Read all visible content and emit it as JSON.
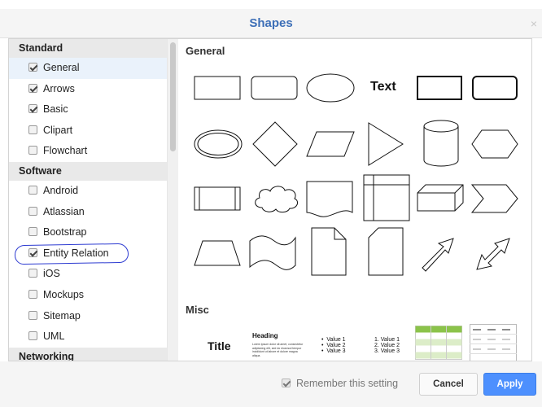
{
  "dialog": {
    "title": "Shapes",
    "close_label": "×"
  },
  "sidebar": {
    "groups": [
      {
        "label": "Standard",
        "items": [
          {
            "label": "General",
            "checked": true,
            "selected": true
          },
          {
            "label": "Arrows",
            "checked": true
          },
          {
            "label": "Basic",
            "checked": true
          },
          {
            "label": "Clipart",
            "checked": false
          },
          {
            "label": "Flowchart",
            "checked": false
          }
        ]
      },
      {
        "label": "Software",
        "items": [
          {
            "label": "Android",
            "checked": false
          },
          {
            "label": "Atlassian",
            "checked": false
          },
          {
            "label": "Bootstrap",
            "checked": false
          },
          {
            "label": "Entity Relation",
            "checked": true,
            "annotated": true
          },
          {
            "label": "iOS",
            "checked": false
          },
          {
            "label": "Mockups",
            "checked": false
          },
          {
            "label": "Sitemap",
            "checked": false
          },
          {
            "label": "UML",
            "checked": false
          }
        ]
      },
      {
        "label": "Networking",
        "items": []
      }
    ]
  },
  "main": {
    "general_title": "General",
    "misc_title": "Misc",
    "text_shape_label": "Text",
    "misc": {
      "title_label": "Title",
      "heading_label": "Heading",
      "heading_body": "Lorem ipsum dolor sit amet, consectetur adipisicing elit, sed do eiusmod tempor incididunt ut labore et dolore magna aliqua.",
      "bullets": [
        "Value 1",
        "Value 2",
        "Value 3"
      ],
      "numbered": [
        "1.  Value 1",
        "2.  Value 2",
        "3.  Value 3"
      ]
    }
  },
  "footer": {
    "remember_label": "Remember this setting",
    "cancel_label": "Cancel",
    "apply_label": "Apply"
  },
  "colors": {
    "title": "#3d6fb7",
    "apply": "#4d90fe",
    "annotation": "#2d3bd1",
    "table_header": "#8bc34a"
  }
}
